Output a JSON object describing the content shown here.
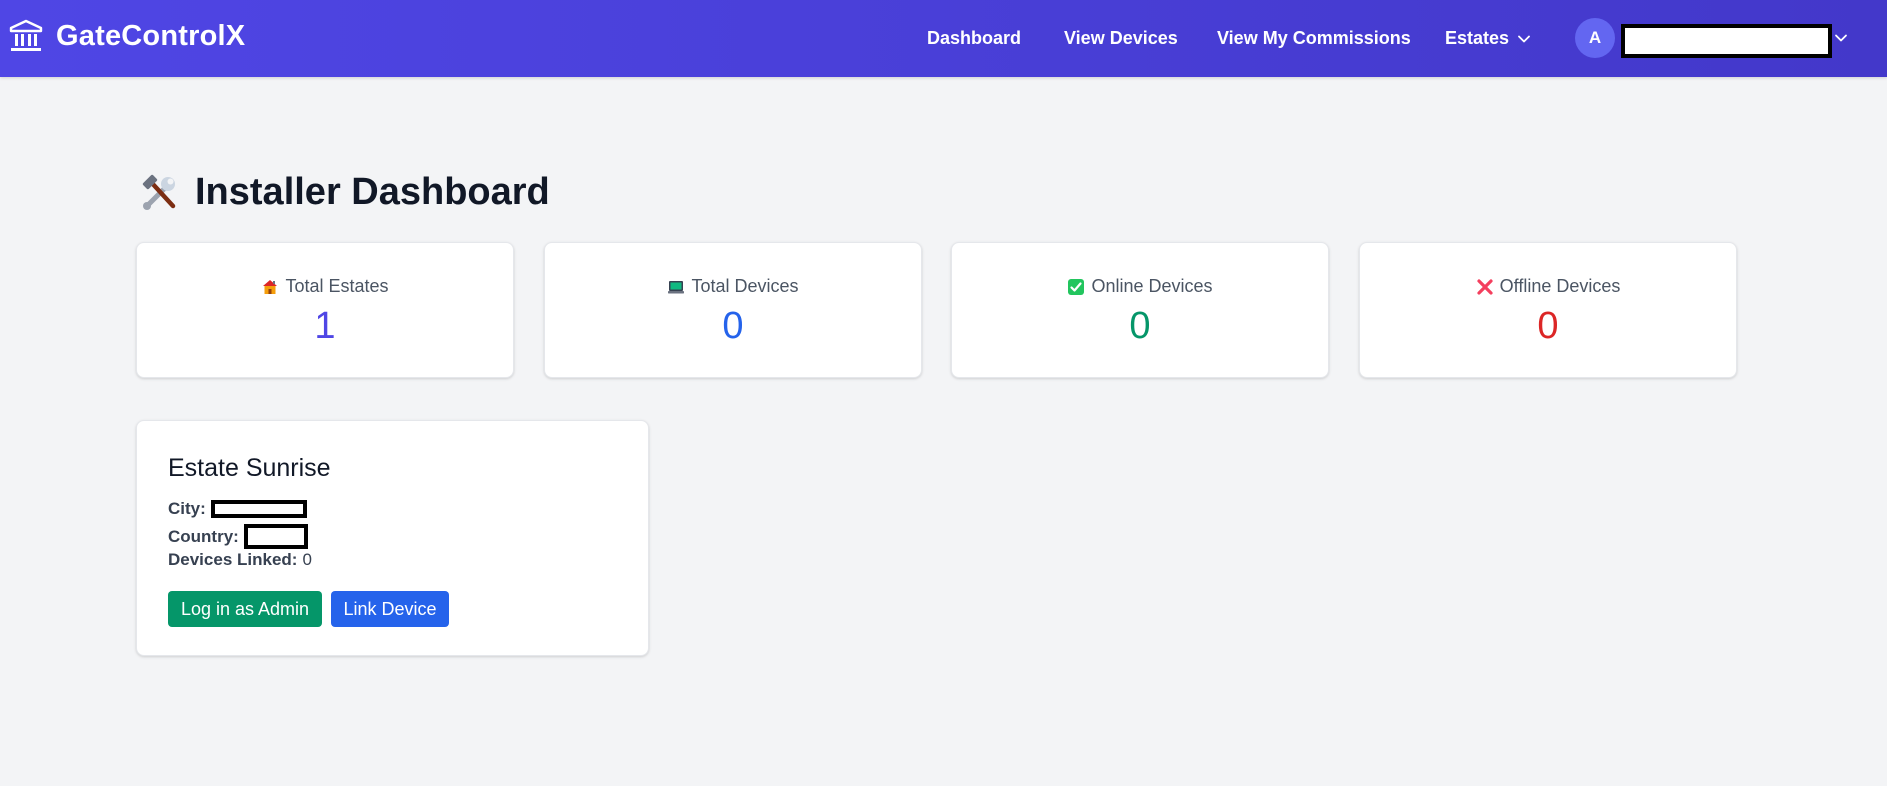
{
  "app": {
    "name": "GateControlX"
  },
  "nav": {
    "dashboard": "Dashboard",
    "view_devices": "View Devices",
    "view_commissions": "View My Commissions",
    "estates": "Estates"
  },
  "user": {
    "avatar_initial": "A"
  },
  "page": {
    "title": "Installer Dashboard",
    "title_icon": "hammer-wrench-icon"
  },
  "stats": [
    {
      "label": "Total Estates",
      "value": "1",
      "icon": "house-icon",
      "color": "#4f46e5"
    },
    {
      "label": "Total Devices",
      "value": "0",
      "icon": "computer-icon",
      "color": "#2563eb"
    },
    {
      "label": "Online Devices",
      "value": "0",
      "icon": "check-box-icon",
      "color": "#059669"
    },
    {
      "label": "Offline Devices",
      "value": "0",
      "icon": "cross-icon",
      "color": "#dc2626"
    }
  ],
  "estate": {
    "name": "Estate Sunrise",
    "city_label": "City:",
    "country_label": "Country:",
    "devices_label": "Devices Linked:",
    "devices_value": "0",
    "admin_button": "Log in as Admin",
    "link_button": "Link Device"
  },
  "colors": {
    "nav_bg": "#4f46e5",
    "admin_button": "#059669",
    "link_button": "#2563eb"
  }
}
